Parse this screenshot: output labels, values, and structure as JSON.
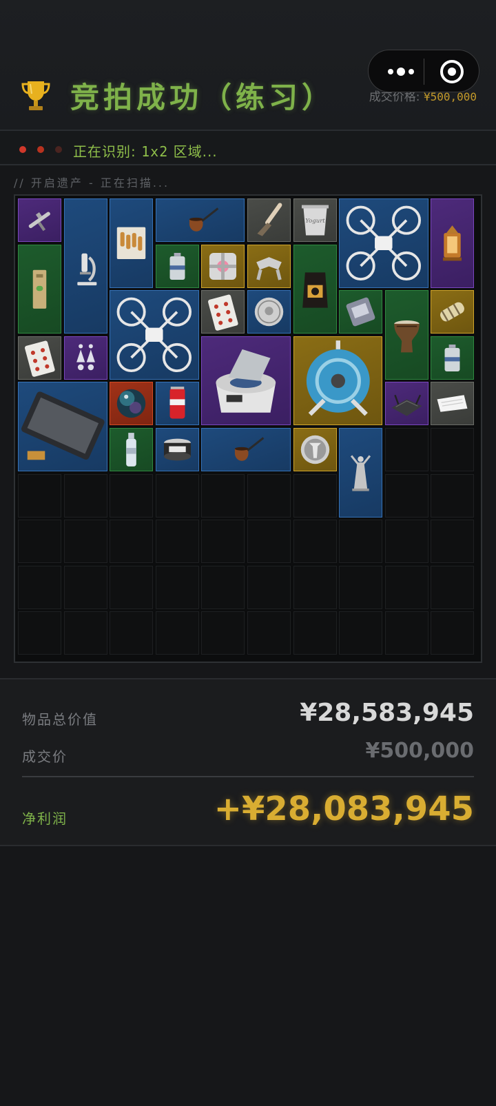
{
  "header": {
    "title": "竞拍成功（练习）",
    "price_label": "成交价格:",
    "price_value": "¥500,000"
  },
  "status": {
    "prefix": "正在识别:",
    "region": "1x2",
    "suffix": "区域..."
  },
  "scan_text": "// 开启遗产 - 正在扫描...",
  "grid": {
    "columns": 10,
    "rows": 10,
    "items": [
      {
        "name": "airbrush",
        "rarity": "purple",
        "icon": "airbrush-icon"
      },
      {
        "name": "microscope",
        "rarity": "blue",
        "icon": "microscope-icon"
      },
      {
        "name": "bullet-box",
        "rarity": "blue",
        "icon": "ammo-box-icon"
      },
      {
        "name": "tobacco-pipe",
        "rarity": "blue",
        "icon": "pipe-icon"
      },
      {
        "name": "paint-brush",
        "rarity": "gray",
        "icon": "brush-icon"
      },
      {
        "name": "yogurt-cup",
        "rarity": "gray",
        "icon": "cup-icon",
        "text": "Yogurt"
      },
      {
        "name": "drone",
        "rarity": "blue",
        "icon": "drone-icon"
      },
      {
        "name": "lantern",
        "rarity": "purple",
        "icon": "lantern-icon"
      },
      {
        "name": "spirit-level",
        "rarity": "green",
        "icon": "level-icon"
      },
      {
        "name": "battery-cell",
        "rarity": "green",
        "icon": "battery-icon"
      },
      {
        "name": "companion-cube",
        "rarity": "gold",
        "icon": "cube-icon"
      },
      {
        "name": "mech-claw",
        "rarity": "gold",
        "icon": "claw-icon"
      },
      {
        "name": "coffee-bag",
        "rarity": "green",
        "icon": "coffee-bag-icon"
      },
      {
        "name": "drone-2",
        "rarity": "blue",
        "icon": "drone-icon"
      },
      {
        "name": "playing-card-spades",
        "rarity": "gray",
        "icon": "card-icon"
      },
      {
        "name": "silver-coin",
        "rarity": "blue",
        "icon": "coin-icon"
      },
      {
        "name": "gadget",
        "rarity": "green",
        "icon": "gadget-icon"
      },
      {
        "name": "djembe-drum",
        "rarity": "green",
        "icon": "drum-icon"
      },
      {
        "name": "scroll-bundle",
        "rarity": "gold",
        "icon": "scroll-icon"
      },
      {
        "name": "playing-card-hearts",
        "rarity": "gray",
        "icon": "card-icon"
      },
      {
        "name": "earrings",
        "rarity": "purple",
        "icon": "earrings-icon"
      },
      {
        "name": "centrifuge",
        "rarity": "purple",
        "icon": "centrifuge-icon"
      },
      {
        "name": "cable-reel",
        "rarity": "gold",
        "icon": "reel-icon"
      },
      {
        "name": "battery-cell-2",
        "rarity": "green",
        "icon": "battery-icon"
      },
      {
        "name": "display-panel",
        "rarity": "blue",
        "icon": "panel-icon"
      },
      {
        "name": "marble-sphere",
        "rarity": "red",
        "icon": "sphere-icon"
      },
      {
        "name": "soda-can",
        "rarity": "blue",
        "icon": "can-icon"
      },
      {
        "name": "router",
        "rarity": "purple",
        "icon": "router-icon"
      },
      {
        "name": "paper-sheet",
        "rarity": "gray",
        "icon": "paper-icon"
      },
      {
        "name": "water-bottle",
        "rarity": "green",
        "icon": "bottle-icon"
      },
      {
        "name": "tin-can",
        "rarity": "blue",
        "icon": "tin-icon"
      },
      {
        "name": "tobacco-pipe-2",
        "rarity": "blue",
        "icon": "pipe-icon"
      },
      {
        "name": "silver-medal",
        "rarity": "gold",
        "icon": "medal-icon"
      },
      {
        "name": "statue",
        "rarity": "blue",
        "icon": "statue-icon"
      }
    ]
  },
  "summary": {
    "total_label": "物品总价值",
    "total_value": "¥28,583,945",
    "deal_label": "成交价",
    "deal_value": "¥500,000",
    "profit_label": "净利润",
    "profit_value": "+¥28,083,945"
  },
  "colors": {
    "title_green": "#7fb24a",
    "gold": "#d9ad32",
    "status_red": "#d0382b"
  }
}
